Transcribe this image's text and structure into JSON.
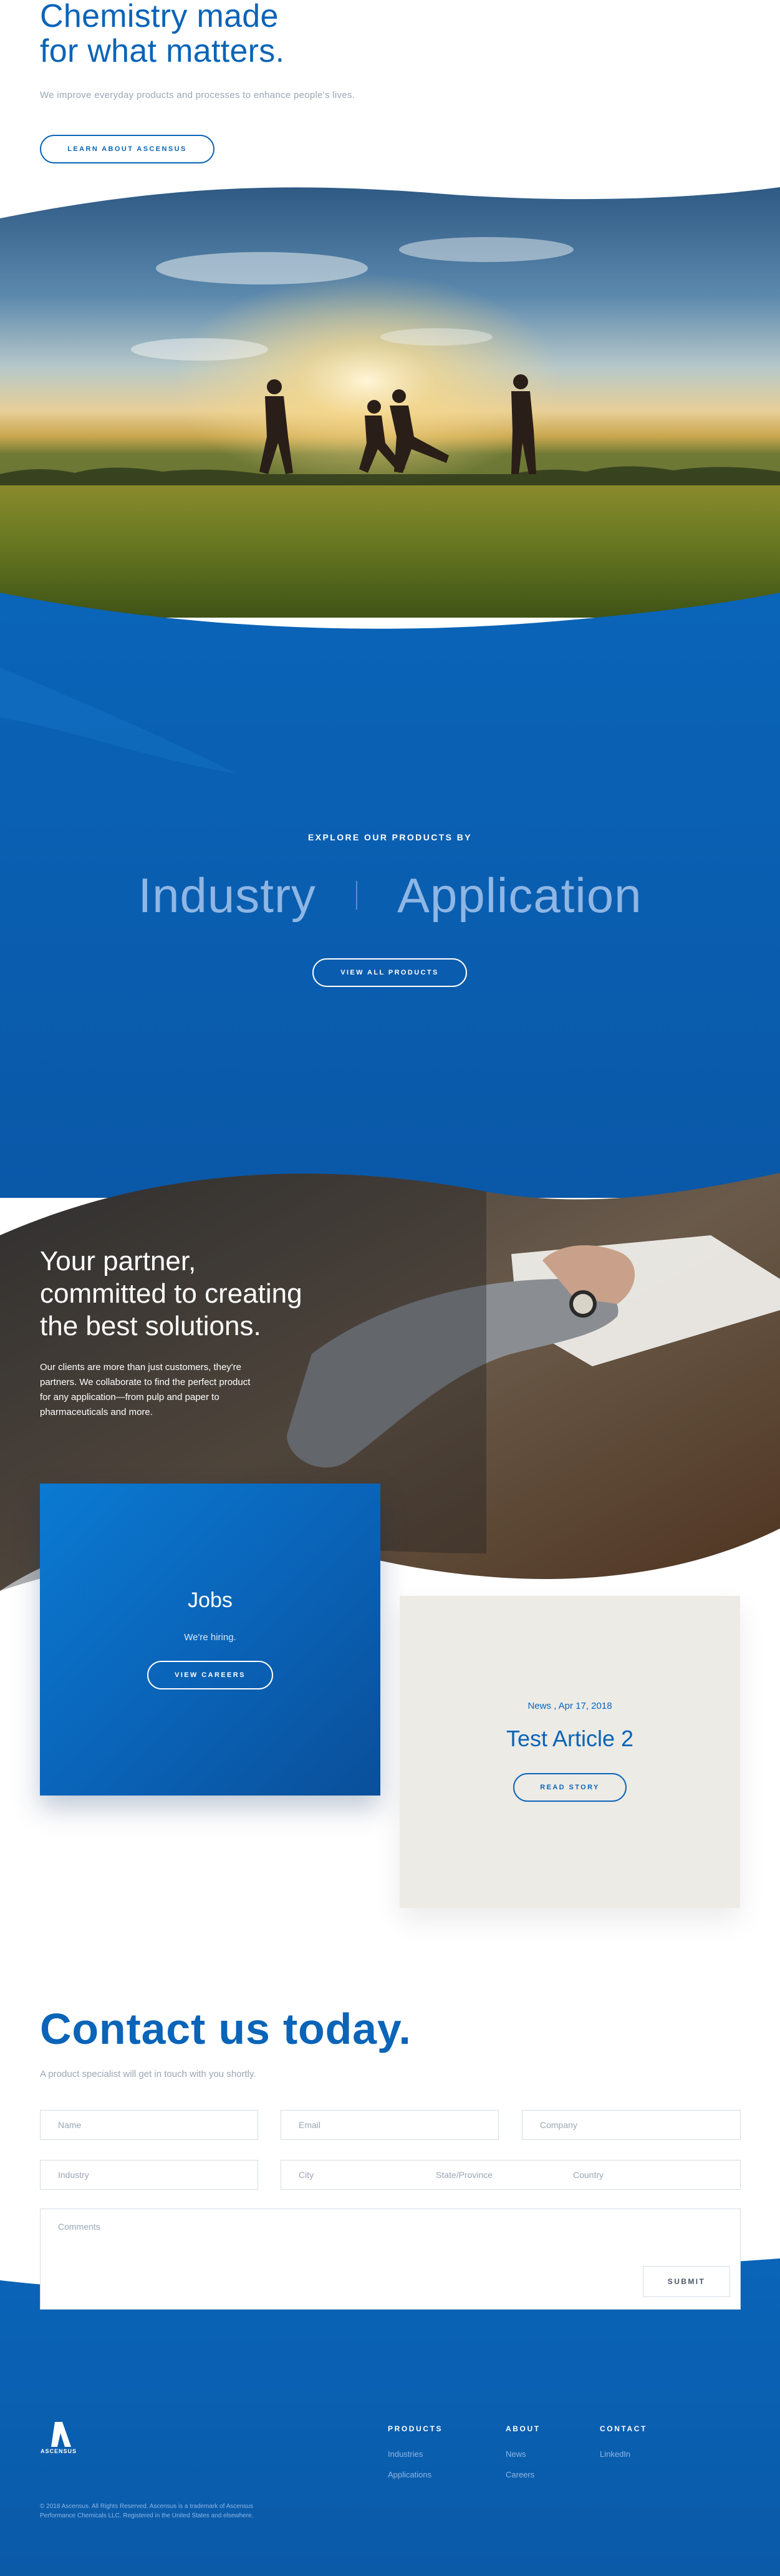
{
  "hero": {
    "title": "Chemistry made\nfor what matters.",
    "subtitle": "We improve everyday products and processes to enhance people's lives.",
    "cta": "LEARN ABOUT ASCENSUS"
  },
  "products": {
    "label": "EXPLORE OUR PRODUCTS BY",
    "options": [
      "Industry",
      "Application"
    ],
    "cta": "VIEW ALL PRODUCTS"
  },
  "partner": {
    "title": "Your partner,\ncommitted to creating\nthe best solutions.",
    "text": "Our clients are more than just customers, they're partners. We collaborate to find the perfect product for any application—from pulp and paper to pharmaceuticals and more."
  },
  "cards": {
    "jobs": {
      "title": "Jobs",
      "subtitle": "We're hiring.",
      "cta": "VIEW CAREERS"
    },
    "news": {
      "meta": "News , Apr 17, 2018",
      "title": "Test Article 2",
      "cta": "READ STORY"
    }
  },
  "contact": {
    "title": "Contact us today.",
    "subtitle": "A product specialist will get in touch with you shortly.",
    "placeholders": {
      "name": "Name",
      "email": "Email",
      "company": "Company",
      "industry": "Industry",
      "city": "City",
      "state": "State/Province",
      "country": "Country",
      "comments": "Comments"
    },
    "submit": "SUBMIT"
  },
  "footer": {
    "logo_text": "ASCENSUS",
    "columns": [
      {
        "heading": "PRODUCTS",
        "links": [
          "Industries",
          "Applications"
        ]
      },
      {
        "heading": "ABOUT",
        "links": [
          "News",
          "Careers"
        ]
      },
      {
        "heading": "CONTACT",
        "links": [
          "LinkedIn"
        ]
      }
    ],
    "copyright": "© 2018 Ascensus. All Rights Reserved. Ascensus is a trademark of Ascensus Performance Chemicals LLC. Registered in the United States and elsewhere."
  },
  "colors": {
    "brand_blue": "#0a64b8",
    "dark_blue": "#0a4f9a",
    "light_blue_text": "#8fb6e4",
    "muted_gray": "#9aa6b4",
    "card_beige": "#ecebe6"
  }
}
